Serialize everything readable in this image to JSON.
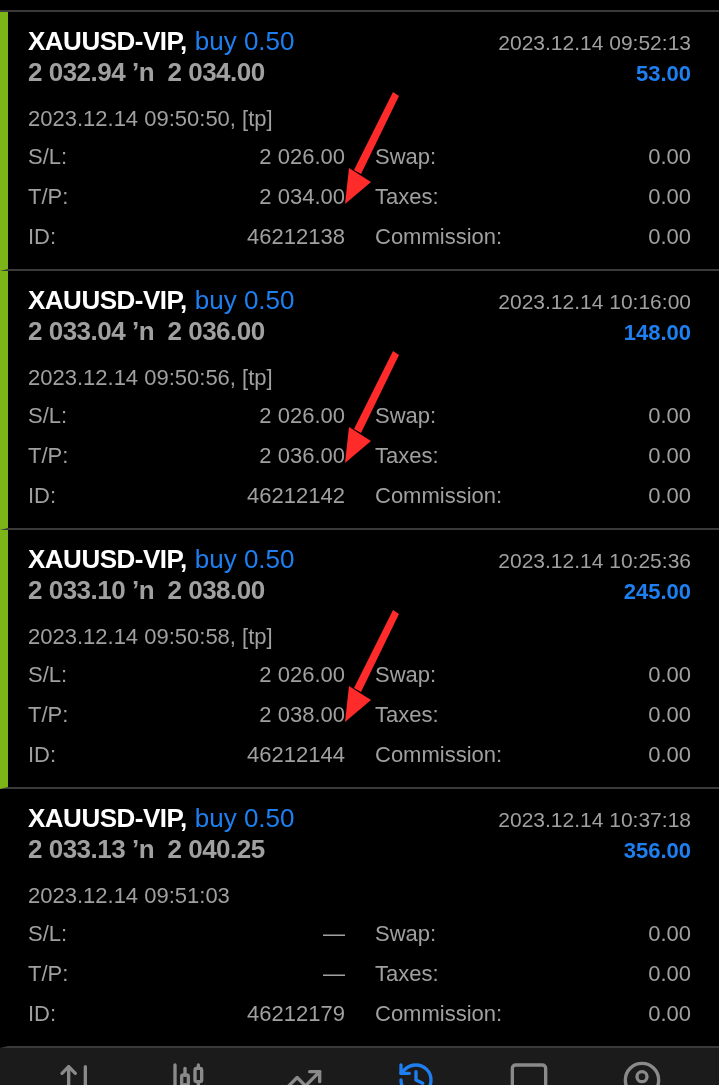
{
  "trades": [
    {
      "title": "XAUUSD-VIP,",
      "side": "buy 0.50",
      "close_time": "2023.12.14 09:52:13",
      "prices": "2 032.94 ’n  2 034.00",
      "profit": "53.00",
      "open_time": "2023.12.14 09:50:50, [tp]",
      "marked": true,
      "annotated": true,
      "fields": [
        [
          "S/L:",
          "2 026.00",
          "Swap:",
          "0.00"
        ],
        [
          "T/P:",
          "2 034.00",
          "Taxes:",
          "0.00"
        ],
        [
          "ID:",
          "46212138",
          "Commission:",
          "0.00"
        ]
      ]
    },
    {
      "title": "XAUUSD-VIP,",
      "side": "buy 0.50",
      "close_time": "2023.12.14 10:16:00",
      "prices": "2 033.04 ’n  2 036.00",
      "profit": "148.00",
      "open_time": "2023.12.14 09:50:56, [tp]",
      "marked": true,
      "annotated": true,
      "fields": [
        [
          "S/L:",
          "2 026.00",
          "Swap:",
          "0.00"
        ],
        [
          "T/P:",
          "2 036.00",
          "Taxes:",
          "0.00"
        ],
        [
          "ID:",
          "46212142",
          "Commission:",
          "0.00"
        ]
      ]
    },
    {
      "title": "XAUUSD-VIP,",
      "side": "buy 0.50",
      "close_time": "2023.12.14 10:25:36",
      "prices": "2 033.10 ’n  2 038.00",
      "profit": "245.00",
      "open_time": "2023.12.14 09:50:58, [tp]",
      "marked": true,
      "annotated": true,
      "fields": [
        [
          "S/L:",
          "2 026.00",
          "Swap:",
          "0.00"
        ],
        [
          "T/P:",
          "2 038.00",
          "Taxes:",
          "0.00"
        ],
        [
          "ID:",
          "46212144",
          "Commission:",
          "0.00"
        ]
      ]
    },
    {
      "title": "XAUUSD-VIP,",
      "side": "buy 0.50",
      "close_time": "2023.12.14 10:37:18",
      "prices": "2 033.13 ’n  2 040.25",
      "profit": "356.00",
      "open_time": "2023.12.14 09:51:03",
      "marked": false,
      "annotated": false,
      "fields": [
        [
          "S/L:",
          "—",
          "Swap:",
          "0.00"
        ],
        [
          "T/P:",
          "—",
          "Taxes:",
          "0.00"
        ],
        [
          "ID:",
          "46212179",
          "Commission:",
          "0.00"
        ]
      ]
    }
  ],
  "nav": [
    {
      "kind": "quotes",
      "selected": false
    },
    {
      "kind": "chart",
      "selected": false
    },
    {
      "kind": "trade",
      "selected": false
    },
    {
      "kind": "history",
      "selected": true
    },
    {
      "kind": "messages",
      "selected": false
    },
    {
      "kind": "profile",
      "selected": false
    }
  ]
}
